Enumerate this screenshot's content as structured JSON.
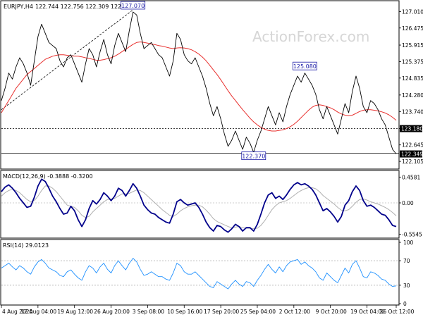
{
  "chart_data": [
    {
      "type": "line",
      "panel": "price",
      "instrument_label": "EURJPY,H4",
      "ohlc_label": "122.744 122.756 122.309 122.349",
      "watermark": "ActionForex.com",
      "ylim": [
        121.9,
        127.3
      ],
      "yticks": [
        "127.010",
        "126.475",
        "125.915",
        "125.375",
        "124.835",
        "124.280",
        "123.740",
        "123.180",
        "122.645",
        "122.105"
      ],
      "last_price": "122.349",
      "horizontal_level": {
        "value": 123.18,
        "label": "123.180"
      },
      "support_level": {
        "value": 122.37
      },
      "annotations": [
        {
          "text": "127.070",
          "x": 36,
          "value": 127.07
        },
        {
          "text": "125.080",
          "x": 83,
          "value": 125.08
        },
        {
          "text": "122.370",
          "x": 69,
          "value": 122.37
        }
      ],
      "trendline": {
        "from": [
          0,
          123.8
        ],
        "to": [
          36,
          127.07
        ]
      },
      "series": [
        {
          "name": "price",
          "color": "#000000",
          "values": [
            124.1,
            124.5,
            125.0,
            124.8,
            125.2,
            125.5,
            125.3,
            125.0,
            124.6,
            125.4,
            126.2,
            126.6,
            126.3,
            126.0,
            125.9,
            125.8,
            125.4,
            125.2,
            125.5,
            125.6,
            125.3,
            125.0,
            124.7,
            125.3,
            125.8,
            125.6,
            125.2,
            125.7,
            126.1,
            125.6,
            125.3,
            125.9,
            126.3,
            126.0,
            125.7,
            126.4,
            127.0,
            126.9,
            126.3,
            125.8,
            125.9,
            126.0,
            125.8,
            125.6,
            125.5,
            125.2,
            124.9,
            125.4,
            126.3,
            126.1,
            125.6,
            125.4,
            125.3,
            125.5,
            125.2,
            124.9,
            124.5,
            124.0,
            123.6,
            123.9,
            123.5,
            123.0,
            122.6,
            122.8,
            123.1,
            122.8,
            122.5,
            122.9,
            122.7,
            122.4,
            122.8,
            123.1,
            123.5,
            123.9,
            123.6,
            123.3,
            123.7,
            123.4,
            123.9,
            124.3,
            124.6,
            124.9,
            124.7,
            125.0,
            124.8,
            124.6,
            124.3,
            123.8,
            123.5,
            123.9,
            123.6,
            123.3,
            123.0,
            123.5,
            124.0,
            123.7,
            124.4,
            124.9,
            124.5,
            123.9,
            123.7,
            124.1,
            124.0,
            123.8,
            123.5,
            123.3,
            122.9,
            122.5,
            122.35
          ]
        },
        {
          "name": "ma",
          "color": "#e8302e",
          "values": [
            123.7,
            123.9,
            124.1,
            124.3,
            124.5,
            124.65,
            124.8,
            124.95,
            125.05,
            125.15,
            125.25,
            125.35,
            125.45,
            125.5,
            125.55,
            125.58,
            125.6,
            125.6,
            125.58,
            125.56,
            125.55,
            125.55,
            125.53,
            125.5,
            125.48,
            125.45,
            125.42,
            125.42,
            125.44,
            125.47,
            125.5,
            125.55,
            125.62,
            125.7,
            125.78,
            125.86,
            125.94,
            126.0,
            126.02,
            126.0,
            125.98,
            125.95,
            125.93,
            125.9,
            125.88,
            125.85,
            125.82,
            125.8,
            125.82,
            125.83,
            125.82,
            125.8,
            125.76,
            125.7,
            125.62,
            125.52,
            125.4,
            125.25,
            125.1,
            124.95,
            124.78,
            124.6,
            124.42,
            124.25,
            124.1,
            123.95,
            123.8,
            123.66,
            123.52,
            123.4,
            123.3,
            123.22,
            123.16,
            123.12,
            123.1,
            123.1,
            123.12,
            123.14,
            123.18,
            123.24,
            123.32,
            123.42,
            123.54,
            123.66,
            123.78,
            123.88,
            123.94,
            123.96,
            123.94,
            123.9,
            123.86,
            123.8,
            123.72,
            123.66,
            123.62,
            123.6,
            123.62,
            123.68,
            123.74,
            123.78,
            123.8,
            123.8,
            123.78,
            123.76,
            123.73,
            123.69,
            123.63,
            123.55,
            123.45
          ]
        }
      ]
    },
    {
      "type": "line",
      "panel": "macd",
      "label": "MACD(12,26,9) -0.3888 -0.3200",
      "ylim": [
        -0.6,
        0.5
      ],
      "yticks": [
        "0.4581",
        "0.00",
        "-0.5545"
      ],
      "series": [
        {
          "name": "macd",
          "color": "#00008b",
          "values": [
            0.2,
            0.28,
            0.32,
            0.26,
            0.18,
            0.08,
            0.0,
            -0.08,
            -0.06,
            0.1,
            0.3,
            0.42,
            0.38,
            0.26,
            0.12,
            0.02,
            -0.1,
            -0.2,
            -0.18,
            -0.06,
            -0.14,
            -0.3,
            -0.42,
            -0.3,
            -0.1,
            0.04,
            -0.02,
            0.06,
            0.18,
            0.12,
            0.04,
            0.12,
            0.26,
            0.22,
            0.12,
            0.22,
            0.34,
            0.26,
            0.12,
            -0.04,
            -0.12,
            -0.18,
            -0.2,
            -0.26,
            -0.3,
            -0.34,
            -0.36,
            -0.2,
            0.02,
            0.06,
            0.0,
            -0.04,
            -0.02,
            0.0,
            -0.08,
            -0.2,
            -0.34,
            -0.44,
            -0.5,
            -0.4,
            -0.42,
            -0.48,
            -0.52,
            -0.46,
            -0.38,
            -0.42,
            -0.5,
            -0.44,
            -0.44,
            -0.5,
            -0.38,
            -0.2,
            0.0,
            0.14,
            0.18,
            0.08,
            0.12,
            0.06,
            0.14,
            0.24,
            0.32,
            0.36,
            0.32,
            0.34,
            0.3,
            0.24,
            0.14,
            0.0,
            -0.14,
            -0.1,
            -0.16,
            -0.24,
            -0.34,
            -0.24,
            -0.04,
            0.04,
            0.2,
            0.3,
            0.22,
            0.04,
            -0.06,
            -0.04,
            -0.08,
            -0.14,
            -0.2,
            -0.22,
            -0.3,
            -0.4,
            -0.42
          ]
        },
        {
          "name": "signal",
          "color": "#b0b0b0",
          "values": [
            0.12,
            0.18,
            0.22,
            0.24,
            0.22,
            0.18,
            0.12,
            0.06,
            0.02,
            0.04,
            0.12,
            0.22,
            0.3,
            0.3,
            0.26,
            0.2,
            0.12,
            0.04,
            -0.04,
            -0.06,
            -0.08,
            -0.14,
            -0.22,
            -0.26,
            -0.24,
            -0.16,
            -0.1,
            -0.04,
            0.02,
            0.06,
            0.07,
            0.08,
            0.12,
            0.16,
            0.16,
            0.17,
            0.2,
            0.23,
            0.22,
            0.18,
            0.12,
            0.06,
            0.0,
            -0.06,
            -0.12,
            -0.17,
            -0.22,
            -0.24,
            -0.2,
            -0.14,
            -0.1,
            -0.07,
            -0.05,
            -0.04,
            -0.04,
            -0.07,
            -0.13,
            -0.2,
            -0.28,
            -0.33,
            -0.36,
            -0.39,
            -0.42,
            -0.44,
            -0.43,
            -0.42,
            -0.44,
            -0.45,
            -0.45,
            -0.46,
            -0.45,
            -0.4,
            -0.32,
            -0.22,
            -0.12,
            -0.05,
            0.0,
            0.02,
            0.04,
            0.08,
            0.13,
            0.18,
            0.22,
            0.25,
            0.27,
            0.27,
            0.25,
            0.2,
            0.13,
            0.08,
            0.03,
            -0.02,
            -0.08,
            -0.13,
            -0.14,
            -0.12,
            -0.06,
            0.01,
            0.06,
            0.07,
            0.05,
            0.02,
            0.0,
            -0.02,
            -0.05,
            -0.08,
            -0.12,
            -0.17,
            -0.23
          ]
        }
      ]
    },
    {
      "type": "line",
      "panel": "rsi",
      "label": "RSI(14) 29.0123",
      "ylim": [
        0,
        100
      ],
      "yticks": [
        "100",
        "70",
        "30",
        "0"
      ],
      "levels": [
        70,
        30
      ],
      "series": [
        {
          "name": "rsi",
          "color": "#1e90ff",
          "values": [
            58,
            62,
            66,
            60,
            55,
            62,
            58,
            52,
            48,
            60,
            68,
            72,
            66,
            58,
            55,
            52,
            46,
            44,
            52,
            55,
            48,
            42,
            38,
            52,
            62,
            58,
            50,
            60,
            66,
            56,
            50,
            62,
            70,
            62,
            55,
            66,
            74,
            68,
            56,
            46,
            48,
            52,
            48,
            44,
            44,
            40,
            38,
            50,
            66,
            62,
            52,
            48,
            48,
            52,
            46,
            40,
            34,
            28,
            26,
            36,
            32,
            28,
            24,
            32,
            38,
            32,
            28,
            36,
            34,
            28,
            38,
            46,
            56,
            64,
            56,
            50,
            60,
            52,
            62,
            68,
            70,
            72,
            64,
            68,
            62,
            58,
            52,
            42,
            38,
            50,
            44,
            38,
            34,
            46,
            58,
            50,
            64,
            70,
            58,
            44,
            42,
            52,
            50,
            46,
            40,
            38,
            32,
            28,
            29
          ]
        }
      ]
    }
  ],
  "x_axis": {
    "labels": [
      "4 Aug 2020",
      "12 Aug 04:00",
      "19 Aug 12:00",
      "26 Aug 20:00",
      "3 Sep 08:00",
      "10 Sep 16:00",
      "17 Sep 20:00",
      "25 Sep 04:00",
      "2 Oct 12:00",
      "9 Oct 20:00",
      "19 Oct 04:00",
      "26 Oct 12:00"
    ],
    "label_positions": [
      0,
      10,
      20,
      30,
      40,
      50,
      60,
      70,
      80,
      90,
      100,
      108
    ]
  }
}
